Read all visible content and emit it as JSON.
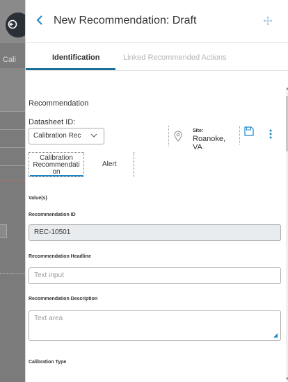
{
  "background": {
    "partial_tab_text": "Cali"
  },
  "header": {
    "title": "New Recommendation: Draft"
  },
  "tabs": [
    {
      "label": "Identification"
    },
    {
      "label": "Linked Recommended Actions"
    }
  ],
  "form": {
    "section_title": "Recommendation",
    "datasheet_label": "Datasheet ID:",
    "datasheet_value": "Calibration Rec",
    "site_label": "Site:",
    "site_value": "Roanoke, VA",
    "subtabs": [
      {
        "label": "Calibration Recommendati on"
      },
      {
        "label": "Alert"
      }
    ],
    "values_label": "Value(s)",
    "fields": {
      "rec_id_label": "Recommendation ID",
      "rec_id_value": "REC-10501",
      "headline_label": "Recommendation Headline",
      "headline_placeholder": "Text input",
      "description_label": "Recommendation Description",
      "description_placeholder": "Text area",
      "calibration_type_label": "Calibration Type"
    }
  },
  "colors": {
    "accent": "#1b86c7",
    "tab_underline": "#1b6f9c"
  }
}
